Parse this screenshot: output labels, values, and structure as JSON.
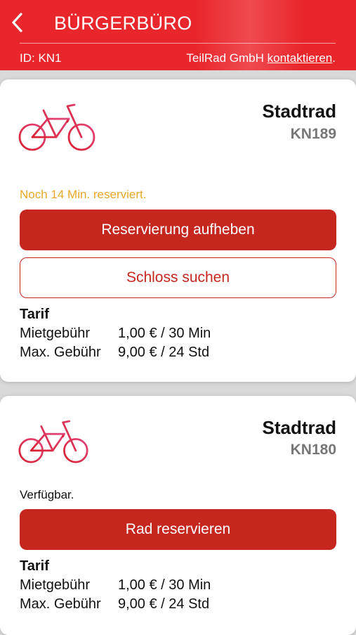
{
  "header": {
    "title": "BÜRGERBÜRO",
    "id_text": "ID: KN1",
    "company": "TeilRad GmbH",
    "contact_link": "kontaktieren",
    "contact_suffix": "."
  },
  "bikes": [
    {
      "type": "Stadtrad",
      "code": "KN189",
      "status": "Noch 14 Min. reserviert.",
      "primary_button": "Reservierung aufheben",
      "secondary_button": "Schloss suchen",
      "tarif": {
        "heading": "Tarif",
        "rows": [
          {
            "label": "Mietgebühr",
            "value": "1,00 € / 30 Min"
          },
          {
            "label": "Max. Gebühr",
            "value": "9,00 € / 24 Std"
          }
        ]
      }
    },
    {
      "type": "Stadtrad",
      "code": "KN180",
      "status": "Verfügbar.",
      "primary_button": "Rad reservieren",
      "tarif": {
        "heading": "Tarif",
        "rows": [
          {
            "label": "Mietgebühr",
            "value": "1,00 € / 30 Min"
          },
          {
            "label": "Max. Gebühr",
            "value": "9,00 € / 24 Std"
          }
        ]
      }
    }
  ],
  "colors": {
    "header_red": "#e8262b",
    "button_red": "#c5271f",
    "reserved_status": "#e9a82b",
    "code_gray": "#777777"
  },
  "icons": {
    "back": "chevron-left-icon",
    "bike": "bicycle-icon"
  }
}
